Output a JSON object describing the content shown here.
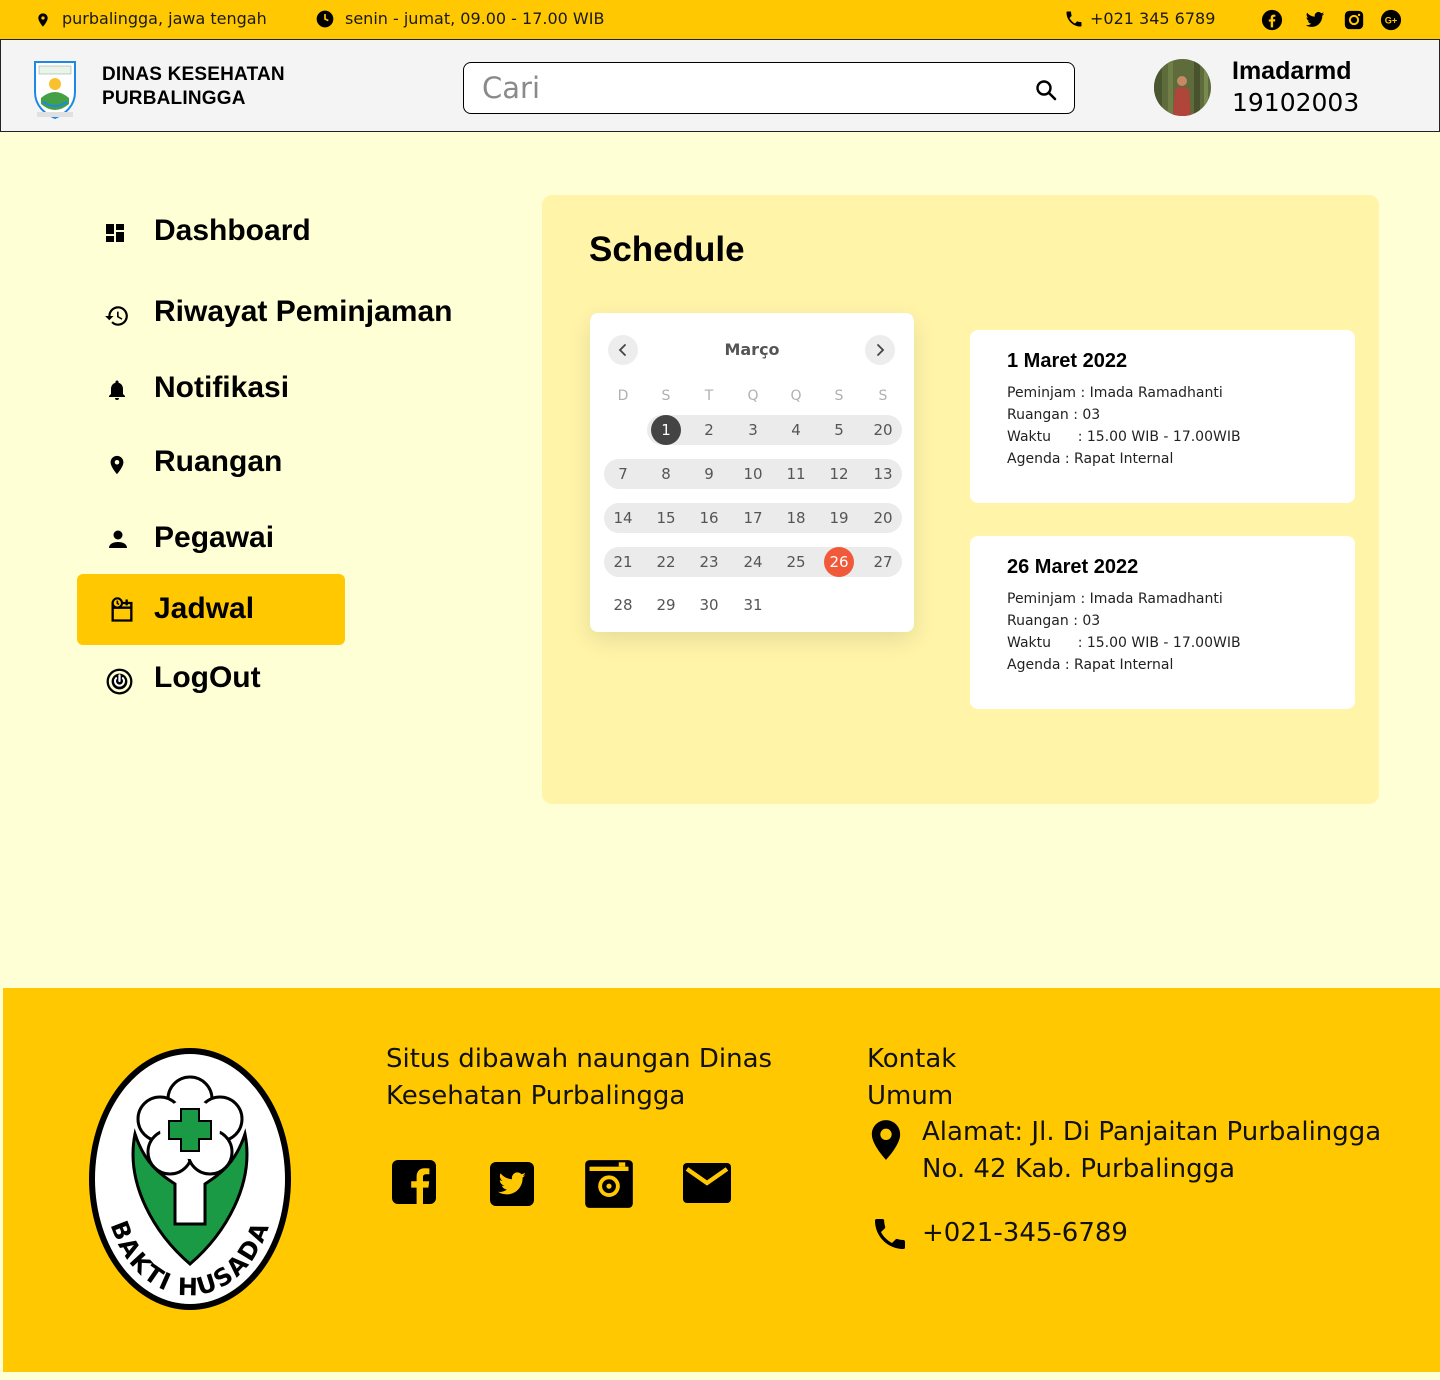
{
  "topbar": {
    "location": "purbalingga,  jawa tengah",
    "hours": "senin - jumat, 09.00 - 17.00 WIB",
    "phone": "+021 345 6789",
    "social_icons": [
      "facebook-icon",
      "twitter-icon",
      "instagram-icon",
      "google-plus-icon"
    ]
  },
  "header": {
    "brand_line1": "DINAS KESEHATAN",
    "brand_line2": "PURBALINGGA",
    "search_placeholder": "Cari",
    "user_name": "Imadarmd",
    "user_id": "19102003"
  },
  "sidebar": {
    "items": [
      {
        "label": "Dashboard",
        "icon": "dashboard-icon"
      },
      {
        "label": "Riwayat Peminjaman",
        "icon": "history-icon"
      },
      {
        "label": "Notifikasi",
        "icon": "bell-icon"
      },
      {
        "label": "Ruangan",
        "icon": "location-pin-icon"
      },
      {
        "label": "Pegawai",
        "icon": "person-icon"
      },
      {
        "label": "Jadwal",
        "icon": "schedule-icon",
        "active": true
      },
      {
        "label": "LogOut",
        "icon": "power-icon"
      }
    ]
  },
  "schedule": {
    "title": "Schedule",
    "calendar": {
      "month": "Março",
      "weekdays": [
        "D",
        "S",
        "T",
        "Q",
        "Q",
        "S",
        "S"
      ],
      "weeks": [
        [
          "",
          "1",
          "2",
          "3",
          "4",
          "5",
          "20"
        ],
        [
          "7",
          "8",
          "9",
          "10",
          "11",
          "12",
          "13"
        ],
        [
          "14",
          "15",
          "16",
          "17",
          "18",
          "19",
          "20"
        ],
        [
          "21",
          "22",
          "23",
          "24",
          "25",
          "26",
          "27"
        ],
        [
          "28",
          "29",
          "30",
          "31",
          "",
          "",
          ""
        ]
      ],
      "selected_day": "1",
      "highlighted_day": "26",
      "colors": {
        "selected": "#444444",
        "highlighted": "#F05A3A"
      }
    },
    "events": [
      {
        "date": "1 Maret 2022",
        "peminjam": "Peminjam : Imada Ramadhanti",
        "ruangan": "Ruangan : 03",
        "waktu": "Waktu      : 15.00 WIB - 17.00WIB",
        "agenda": "Agenda : Rapat Internal"
      },
      {
        "date": "26 Maret 2022",
        "peminjam": "Peminjam : Imada Ramadhanti",
        "ruangan": "Ruangan : 03",
        "waktu": "Waktu      : 15.00 WIB - 17.00WIB",
        "agenda": "Agenda : Rapat Internal"
      }
    ]
  },
  "footer": {
    "logo_text": "BAKTI HUSADA",
    "about_line1": "Situs dibawah naungan Dinas",
    "about_line2": "Kesehatan Purbalingga",
    "social_icons": [
      "facebook-icon",
      "twitter-icon",
      "instagram-icon",
      "mail-icon"
    ],
    "contact_title1": "Kontak",
    "contact_title2": "Umum",
    "address_line1": "Alamat: Jl. Di Panjaitan Purbalingga",
    "address_line2": "No. 42 Kab. Purbalingga",
    "phone": "+021-345-6789"
  },
  "colors": {
    "accent": "#FFC800",
    "page_background": "#FFFFD6",
    "panel_background": "#FFF4A8"
  }
}
